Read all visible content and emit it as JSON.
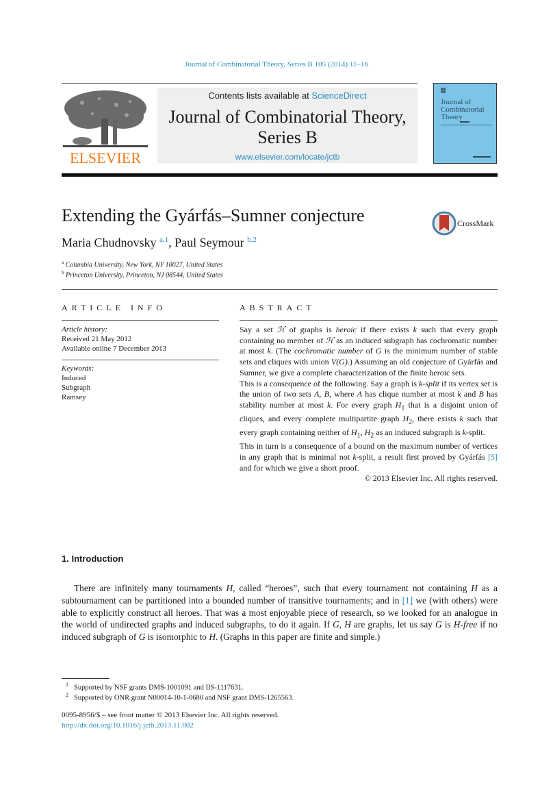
{
  "running_head": "Journal of Combinatorial Theory, Series B 105 (2014) 11–16",
  "banner": {
    "contents_prefix": "Contents lists available at ",
    "contents_link": "ScienceDirect",
    "journal_title_line1": "Journal of Combinatorial Theory,",
    "journal_title_line2": "Series B",
    "url": "www.elsevier.com/locate/jctb"
  },
  "publisher_logo_text": "ELSEVIER",
  "cover": {
    "title_lines": [
      "Journal of",
      "Combinatorial",
      "Theory"
    ]
  },
  "article": {
    "title": "Extending the Gyárfás–Sumner conjecture",
    "crossmark_label": "CrossMark",
    "authors": [
      {
        "name": "Maria Chudnovsky",
        "marks": "a,1"
      },
      {
        "name": "Paul Seymour",
        "marks": "b,2"
      }
    ],
    "author_separator": ", ",
    "affiliations": [
      {
        "mark": "a",
        "text": "Columbia University, New York, NY 10027, United States"
      },
      {
        "mark": "b",
        "text": "Princeton University, Princeton, NJ 08544, United States"
      }
    ]
  },
  "article_info": {
    "heading": "ARTICLE INFO",
    "history_label": "Article history:",
    "received": "Received 21 May 2012",
    "available": "Available online 7 December 2013",
    "keywords_label": "Keywords:",
    "keywords": [
      "Induced",
      "Subgraph",
      "Ramsey"
    ]
  },
  "abstract": {
    "heading": "ABSTRACT",
    "p1": {
      "a": "Say a set ",
      "sym": "ℋ",
      "b": " of graphs is ",
      "heroic": "heroic",
      "c": " if there exists ",
      "k": "k",
      "d": " such that every graph containing no member of ",
      "e": " as an induced subgraph has cochromatic number at most ",
      "f": ". (The ",
      "coch": "cochromatic number",
      "g": " of ",
      "G": "G",
      "h": " is the minimum number of stable sets and cliques with union ",
      "VG": "V(G)",
      "i": ".) Assuming an old conjecture of Gyárfás and Sumner, we give a complete characterization of the finite heroic sets."
    },
    "p2": {
      "a": "This is a consequence of the following. Say a graph is ",
      "ksplit": "k-split",
      "b": " if its vertex set is the union of two sets ",
      "A": "A",
      "B": "B",
      "c": ", where ",
      "d": " has clique number at most ",
      "k": "k",
      "e": " and ",
      "f": " has stability number at most ",
      "g": ". For every graph ",
      "H1": "H",
      "sub1": "1",
      "h": " that is a disjoint union of cliques, and every complete multipartite graph ",
      "sub2": "2",
      "i": ", there exists ",
      "j": " such that every graph containing neither of ",
      "l": " as an induced subgraph is ",
      "m": "-split."
    },
    "p3": {
      "a": "This in turn is a consequence of a bound on the maximum number of vertices in any graph that is minimal not ",
      "k": "k",
      "b": "-split, a result first proved by Gyárfás ",
      "ref": "[5]",
      "c": " and for which we give a short proof."
    },
    "copyright": "© 2013 Elsevier Inc. All rights reserved."
  },
  "introduction": {
    "heading": "1. Introduction",
    "s1": "There are infinitely many tournaments ",
    "H": "H",
    "s2": ", called “heroes”, such that every tournament not containing ",
    "s3": " as a subtournament can be partitioned into a bounded number of transitive tournaments; and in ",
    "ref": "[1]",
    "s4": " we (with others) were able to explicitly construct all heroes. That was a most enjoyable piece of research, so we looked for an analogue in the world of undirected graphs and induced subgraphs, to do it again. If ",
    "GH": "G, H",
    "s5": " are graphs, let us say ",
    "G": "G",
    "s6": " is ",
    "Hfree": "H-free",
    "s7": " if no induced subgraph of ",
    "s8": " is isomorphic to ",
    "s9": ". (Graphs in this paper are finite and simple.)"
  },
  "footnotes": [
    {
      "mark": "1",
      "text": "Supported by NSF grants DMS-1001091 and IIS-1117631."
    },
    {
      "mark": "2",
      "text": "Supported by ONR grant N00014-10-1-0680 and NSF grant DMS-1265563."
    }
  ],
  "front_matter": "0095-8956/$ – see front matter  © 2013 Elsevier Inc. All rights reserved.",
  "doi": "http://dx.doi.org/10.1016/j.jctb.2013.11.002",
  "colors": {
    "link": "#2a8fc2",
    "elsevier_orange": "#f07a1a",
    "cover_blue": "#7dc5e8",
    "crossmark_red": "#c0392b"
  }
}
